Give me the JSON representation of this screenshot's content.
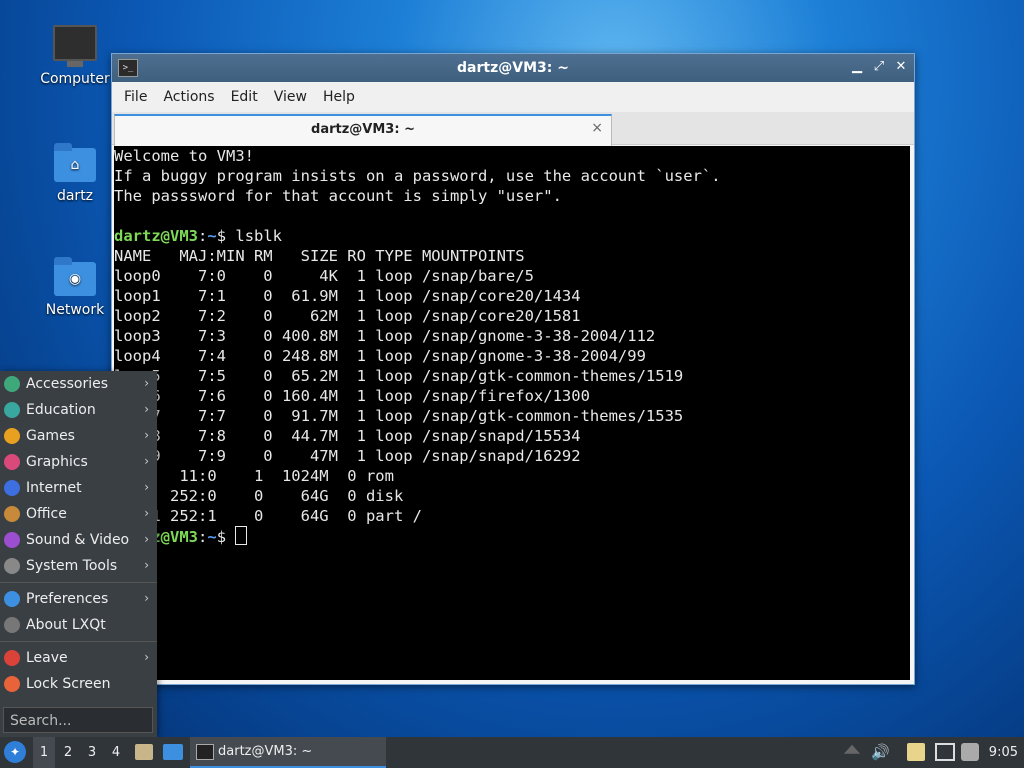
{
  "desktop": {
    "icons": [
      {
        "label": "Computer"
      },
      {
        "label": "dartz"
      },
      {
        "label": "Network"
      }
    ]
  },
  "window": {
    "title": "dartz@VM3: ~",
    "menu": [
      "File",
      "Actions",
      "Edit",
      "View",
      "Help"
    ],
    "tab_label": "dartz@VM3: ~",
    "close_glyph": "×"
  },
  "terminal": {
    "welcome": [
      "Welcome to VM3!",
      "If a buggy program insists on a password, use the account `user`.",
      "The passsword for that account is simply \"user\"."
    ],
    "prompt_user": "dartz@VM3",
    "prompt_sep": ":",
    "prompt_path": "~",
    "prompt_end": "$ ",
    "command": "lsblk",
    "header": "NAME   MAJ:MIN RM   SIZE RO TYPE MOUNTPOINTS",
    "rows": [
      "loop0    7:0    0     4K  1 loop /snap/bare/5",
      "loop1    7:1    0  61.9M  1 loop /snap/core20/1434",
      "loop2    7:2    0    62M  1 loop /snap/core20/1581",
      "loop3    7:3    0 400.8M  1 loop /snap/gnome-3-38-2004/112",
      "loop4    7:4    0 248.8M  1 loop /snap/gnome-3-38-2004/99",
      "l   5    7:5    0  65.2M  1 loop /snap/gtk-common-themes/1519",
      "    6    7:6    0 160.4M  1 loop /snap/firefox/1300",
      "    7    7:7    0  91.7M  1 loop /snap/gtk-common-themes/1535",
      "    8    7:8    0  44.7M  1 loop /snap/snapd/15534",
      "    9    7:9    0    47M  1 loop /snap/snapd/16292",
      "       11:0    1  1024M  0 rom",
      "      252:0    0    64G  0 disk",
      "   a1 252:1    0    64G  0 part /"
    ]
  },
  "startmenu": {
    "items": [
      {
        "label": "Accessories",
        "color": "#3ea87a"
      },
      {
        "label": "Education",
        "color": "#3aa6a0"
      },
      {
        "label": "Games",
        "color": "#e8a020"
      },
      {
        "label": "Graphics",
        "color": "#d94a7a"
      },
      {
        "label": "Internet",
        "color": "#3d6fe0"
      },
      {
        "label": "Office",
        "color": "#c78a3a"
      },
      {
        "label": "Sound & Video",
        "color": "#9b4fd0"
      },
      {
        "label": "System Tools",
        "color": "#888888"
      },
      {
        "label": "Preferences",
        "color": "#3d8fe0"
      },
      {
        "label": "About LXQt",
        "color": "#777777"
      },
      {
        "label": "Leave",
        "color": "#d9433a"
      },
      {
        "label": "Lock Screen",
        "color": "#e8623a"
      }
    ],
    "search_placeholder": "Search..."
  },
  "taskbar": {
    "workspaces": [
      "1",
      "2",
      "3",
      "4"
    ],
    "app_label": "dartz@VM3: ~",
    "clock": "9:05"
  }
}
